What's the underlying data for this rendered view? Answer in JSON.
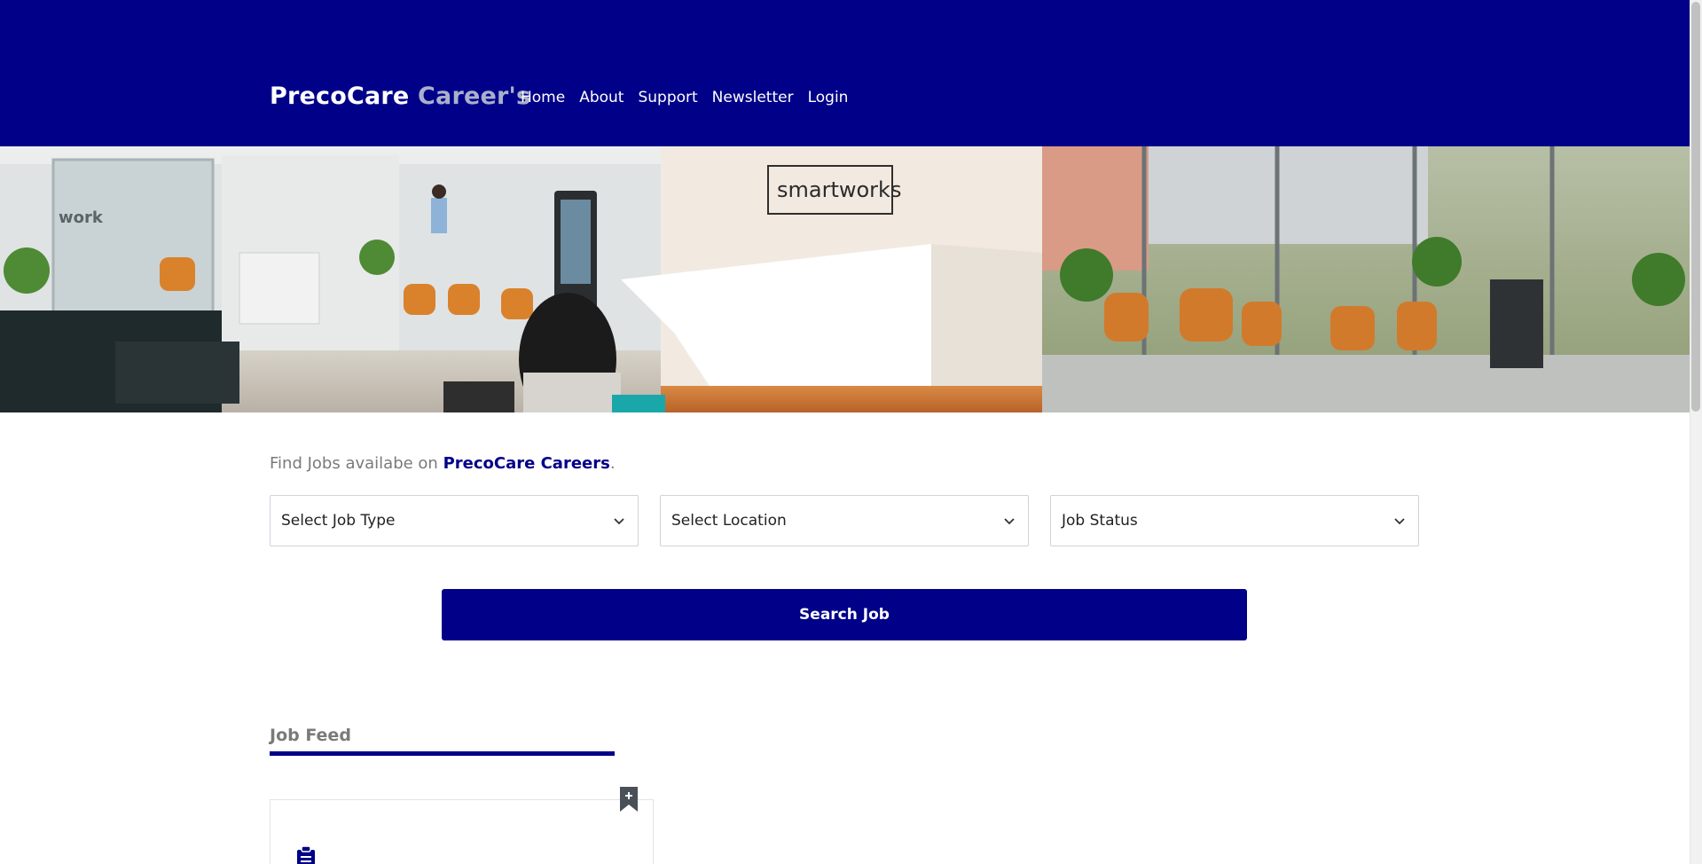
{
  "header": {
    "brand_main": "PrecoCare",
    "brand_accent": "Career's",
    "nav": [
      {
        "label": "Home"
      },
      {
        "label": "About"
      },
      {
        "label": "Support"
      },
      {
        "label": "Newsletter"
      },
      {
        "label": "Login"
      }
    ]
  },
  "hero": {
    "sign_text": "smartworks",
    "wall_text": "work"
  },
  "search": {
    "prefix": "Find Jobs availabe on ",
    "site": "PrecoCare Careers",
    "suffix": ".",
    "job_type": "Select Job Type",
    "location": "Select Location",
    "status": "Job Status",
    "button": "Search Job"
  },
  "feed": {
    "title": "Job Feed"
  },
  "colors": {
    "brand": "#000088",
    "accent_text": "#aab0cc",
    "muted_text": "#7a7a7a"
  }
}
